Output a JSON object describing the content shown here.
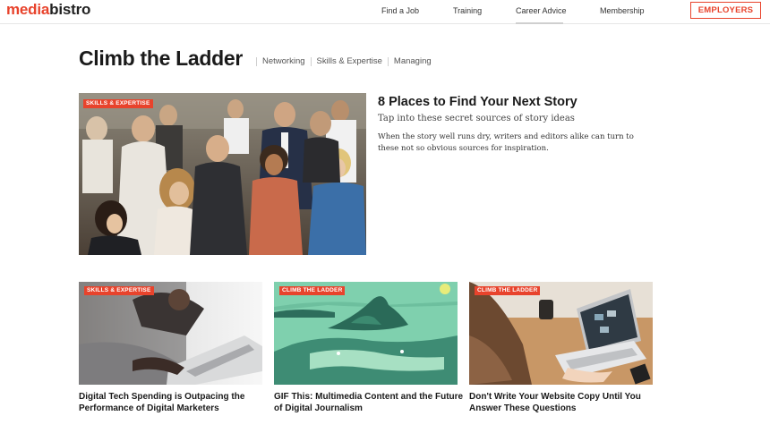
{
  "logo": {
    "part1": "media",
    "part2": "bistro"
  },
  "nav": {
    "items": [
      {
        "label": "Find a Job"
      },
      {
        "label": "Training"
      },
      {
        "label": "Career Advice"
      },
      {
        "label": "Membership"
      }
    ],
    "active": "Career Advice",
    "employers_label": "EMPLOYERS"
  },
  "page": {
    "title": "Climb the Ladder",
    "subnav": [
      "Networking",
      "Skills & Expertise",
      "Managing"
    ]
  },
  "hero": {
    "badge": "SKILLS & EXPERTISE",
    "title": "8 Places to Find Your Next Story",
    "subtitle": "Tap into these secret sources of story ideas",
    "description": "When the story well runs dry, writers and editors alike can turn to these not so obvious sources for inspiration."
  },
  "cards": [
    {
      "badge": "SKILLS & EXPERTISE",
      "title": "Digital Tech Spending is Outpacing the Performance of Digital Marketers"
    },
    {
      "badge": "CLIMB THE LADDER",
      "title": "GIF This: Multimedia Content and the Future of Digital Journalism"
    },
    {
      "badge": "CLIMB THE LADDER",
      "title": "Don't Write Your Website Copy Until You Answer These Questions"
    }
  ],
  "colors": {
    "accent": "#e8432c",
    "text": "#1a1a1a",
    "gif_bg": "#7fd0ae"
  }
}
